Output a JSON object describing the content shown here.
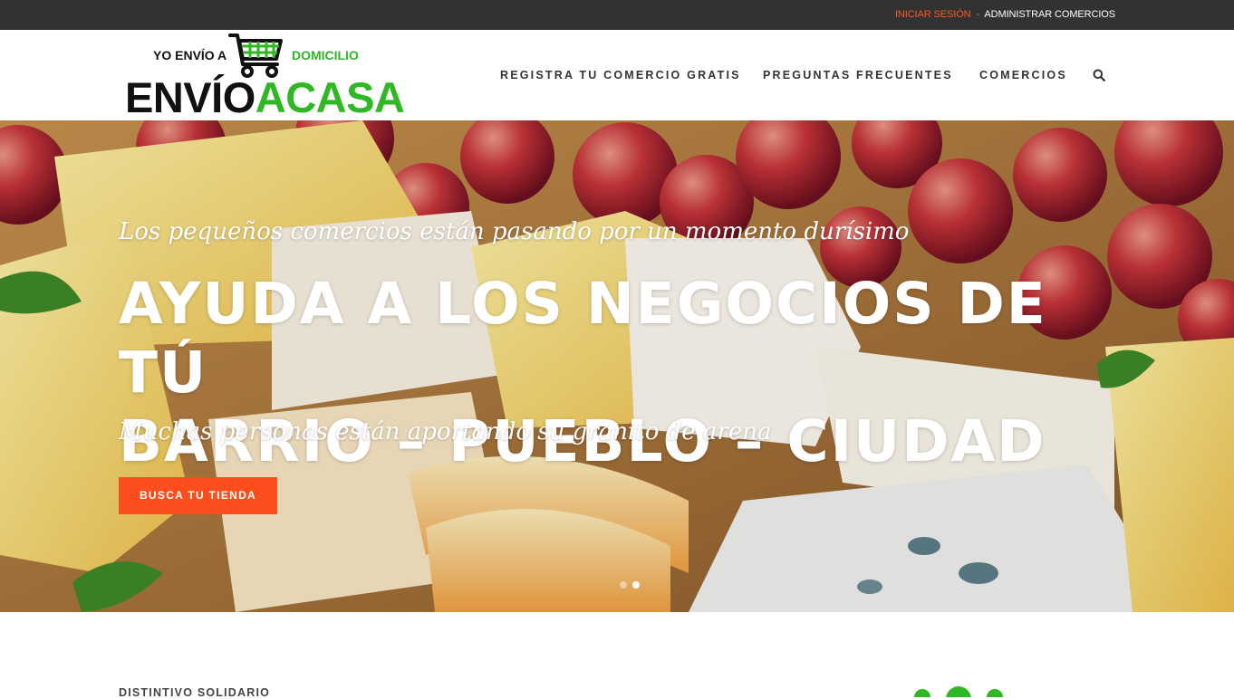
{
  "topbar": {
    "login_label": "INICIAR SESIÓN",
    "separator": "-",
    "admin_label": "ADMINISTRAR COMERCIOS"
  },
  "logo": {
    "tagline_left": "YO ENVÍO A",
    "tagline_right": "DOMICILIO",
    "word_dark": "ENVÍO",
    "word_green": "ACASA",
    "icon": "shopping-cart-icon"
  },
  "nav": {
    "items": [
      {
        "label": "REGISTRA TU COMERCIO GRATIS"
      },
      {
        "label": "PREGUNTAS FRECUENTES"
      },
      {
        "label": "COMERCIOS"
      }
    ],
    "search_icon": "search-icon"
  },
  "hero": {
    "pre_title": "Los pequeños comercios están pasando por un momento durísimo",
    "title_line1": "AYUDA A LOS NEGOCIOS DE TÚ",
    "title_line2": "BARRIO – PUEBLO – CIUDAD",
    "subtitle": "Muchas personas están aportando su granito de arena",
    "button_label": "BUSCA TU TIENDA",
    "slides_total": 2,
    "active_slide": 2
  },
  "section": {
    "title": "DISTINTIVO SOLIDARIO"
  },
  "colors": {
    "accent": "#ff4e1d",
    "brand_green": "#2fb824",
    "topbar_bg": "#323232"
  }
}
